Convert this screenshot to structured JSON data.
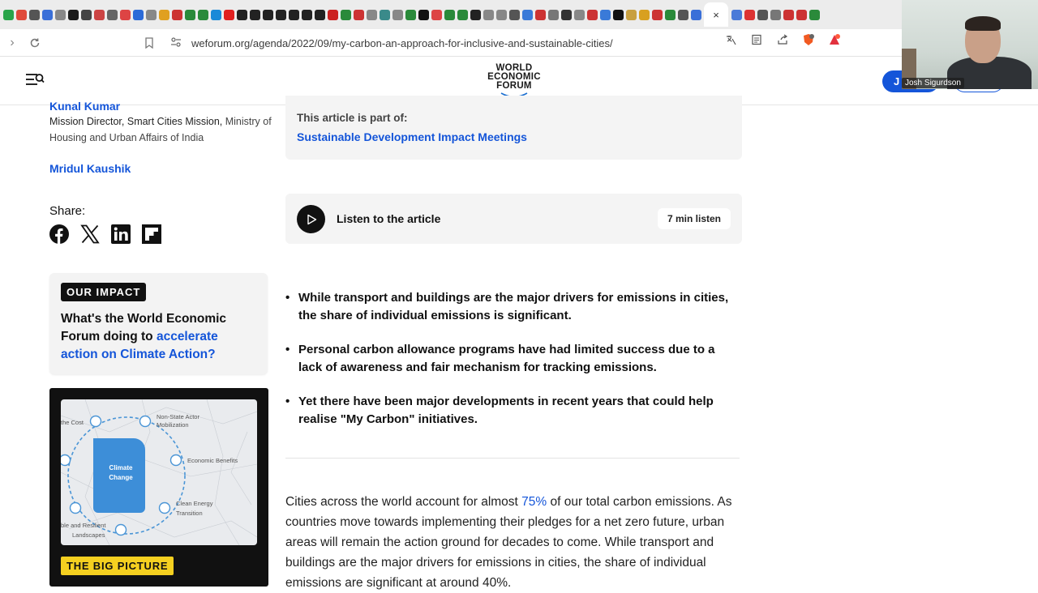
{
  "browser": {
    "url": "weforum.org/agenda/2022/09/my-carbon-an-approach-for-inclusive-and-sustainable-cities/",
    "active_tab_close": "×",
    "tab_icon_colors": [
      "#2aa44a",
      "#e04a3a",
      "#555",
      "#3a6fd8",
      "#888",
      "#1a1a1a",
      "#444",
      "#c44",
      "#666",
      "#d44",
      "#2b6ad8",
      "#888",
      "#e0a020",
      "#c33",
      "#2a8a3a",
      "#2a8a3a",
      "#1a8ad8",
      "#e02020",
      "#222",
      "#222",
      "#222",
      "#222",
      "#222",
      "#222",
      "#222",
      "#c22",
      "#2a8a3a",
      "#c33",
      "#888",
      "#3a8a8a",
      "#888",
      "#2a8a3a",
      "#111",
      "#d44",
      "#2a8a3a",
      "#2a8a3a",
      "#222",
      "#888",
      "#888",
      "#555",
      "#3a7ad8",
      "#c33",
      "#777",
      "#333",
      "#888",
      "#c33",
      "#3a7ad8",
      "#111",
      "#c8a040",
      "#d8a020",
      "#c33",
      "#2a8a3a",
      "#555",
      "#3a6fd8"
    ],
    "tab_icon_colors_right": [
      "#4a7ad8",
      "#d33",
      "#555",
      "#777",
      "#c33",
      "#c33",
      "#2a8a3a"
    ]
  },
  "site": {
    "logo_lines": [
      "WORLD",
      "ECONOMIC",
      "FORUM"
    ],
    "join_label": "J",
    "webcam_name": "Josh Sigurdson"
  },
  "authors": [
    {
      "name": "Kunal Kumar",
      "role_bold": "Mission Director, Smart Cities Mission,",
      "role_rest": " Ministry of Housing and Urban Affairs of India"
    },
    {
      "name": "Mridul Kaushik"
    }
  ],
  "share": {
    "label": "Share:",
    "icons": [
      "facebook-icon",
      "x-icon",
      "linkedin-icon",
      "flipboard-icon"
    ]
  },
  "impact": {
    "tag": "OUR IMPACT",
    "text_plain": "What's the World Economic Forum doing to ",
    "text_link": "accelerate action on Climate Action?"
  },
  "big_picture": {
    "tag": "THE BIG PICTURE",
    "center_label_1": "Climate",
    "center_label_2": "Change",
    "labels": [
      "the Cost",
      "Non-State Actor",
      "Mobilization",
      "Economic Benefits",
      "Clean Energy",
      "Transition",
      "ble and Resilient",
      "Landscapes"
    ]
  },
  "part_of": {
    "label": "This article is part of:",
    "link": "Sustainable Development Impact Meetings"
  },
  "listen": {
    "label": "Listen to the article",
    "duration": "7 min listen"
  },
  "bullets": [
    "While transport and buildings are the major drivers for emissions in cities, the share of individual emissions is significant.",
    "Personal carbon allowance programs have had limited success due to a lack of awareness and fair mechanism for tracking emissions.",
    "Yet there have been major developments in recent years that could help realise \"My Carbon\" initiatives."
  ],
  "body": {
    "p1_before": "Cities across the world account for almost ",
    "p1_link": "75%",
    "p1_after": " of our total carbon emissions. As countries move towards implementing their pledges for a net zero future, urban areas will remain the action ground for decades to come. While transport and buildings are the major drivers for emissions in cities, the share of individual emissions are significant at around 40%."
  }
}
